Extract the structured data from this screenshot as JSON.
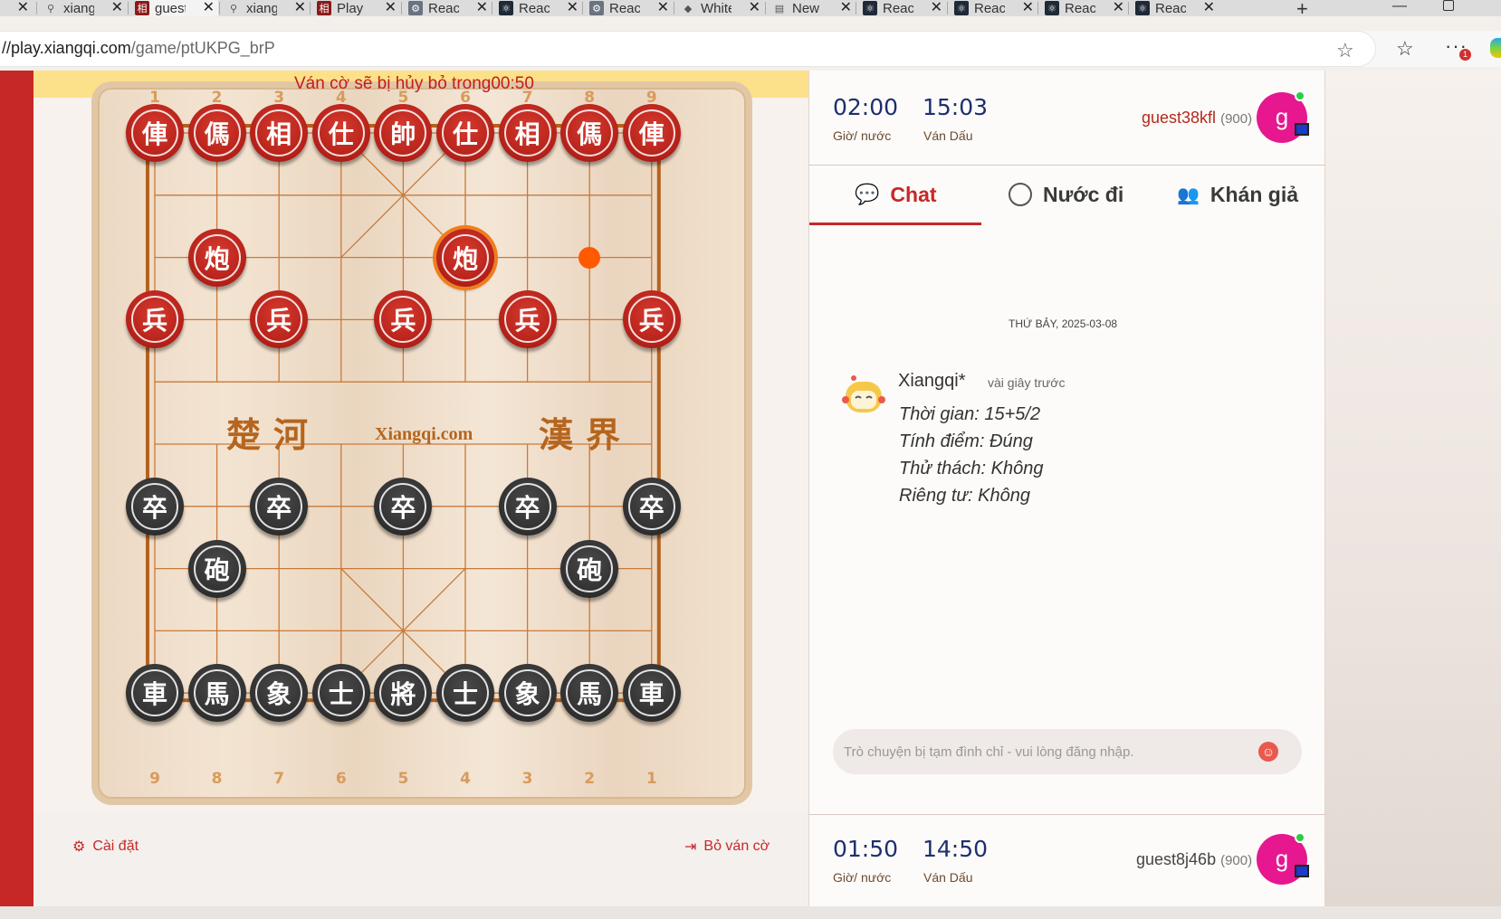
{
  "browser": {
    "tabs": [
      {
        "label": "",
        "icon": "close-icon",
        "active": false
      },
      {
        "label": "xiangq",
        "icon": "search-icon",
        "active": false
      },
      {
        "label": "guest",
        "icon": "xiangqi-favicon",
        "active": true
      },
      {
        "label": "xiangq",
        "icon": "search-icon",
        "active": false
      },
      {
        "label": "Play",
        "icon": "xiangqi-favicon",
        "active": false
      },
      {
        "label": "React",
        "icon": "gear-icon",
        "active": false
      },
      {
        "label": "React",
        "icon": "react-icon",
        "active": false
      },
      {
        "label": "React",
        "icon": "gear-icon",
        "active": false
      },
      {
        "label": "White",
        "icon": "app-icon",
        "active": false
      },
      {
        "label": "New",
        "icon": "page-icon",
        "active": false
      },
      {
        "label": "React",
        "icon": "react-icon",
        "active": false
      },
      {
        "label": "React",
        "icon": "react-icon",
        "active": false
      },
      {
        "label": "React",
        "icon": "react-icon",
        "active": false
      },
      {
        "label": "React",
        "icon": "react-icon",
        "active": false
      }
    ],
    "url_host": "//play.xiangqi.com",
    "url_path": "/game/ptUKPG_brP",
    "notification_count": "1"
  },
  "game": {
    "notice": "Ván cờ sẽ bị hủy bỏ trong00:50",
    "top_coords": [
      "1",
      "2",
      "3",
      "4",
      "5",
      "6",
      "7",
      "8",
      "9"
    ],
    "bottom_coords": [
      "9",
      "8",
      "7",
      "6",
      "5",
      "4",
      "3",
      "2",
      "1"
    ],
    "river_left": "楚河",
    "river_right": "漢界",
    "river_brand": "Xiangqi.com",
    "pieces": [
      {
        "side": "red",
        "glyph": "俥",
        "file": 0,
        "rank": 0
      },
      {
        "side": "red",
        "glyph": "傌",
        "file": 1,
        "rank": 0
      },
      {
        "side": "red",
        "glyph": "相",
        "file": 2,
        "rank": 0
      },
      {
        "side": "red",
        "glyph": "仕",
        "file": 3,
        "rank": 0
      },
      {
        "side": "red",
        "glyph": "帥",
        "file": 4,
        "rank": 0
      },
      {
        "side": "red",
        "glyph": "仕",
        "file": 5,
        "rank": 0
      },
      {
        "side": "red",
        "glyph": "相",
        "file": 6,
        "rank": 0
      },
      {
        "side": "red",
        "glyph": "傌",
        "file": 7,
        "rank": 0
      },
      {
        "side": "red",
        "glyph": "俥",
        "file": 8,
        "rank": 0
      },
      {
        "side": "red",
        "glyph": "炮",
        "file": 1,
        "rank": 2
      },
      {
        "side": "red",
        "glyph": "炮",
        "file": 5,
        "rank": 2,
        "selected": true
      },
      {
        "side": "red",
        "glyph": "兵",
        "file": 0,
        "rank": 3
      },
      {
        "side": "red",
        "glyph": "兵",
        "file": 2,
        "rank": 3
      },
      {
        "side": "red",
        "glyph": "兵",
        "file": 4,
        "rank": 3
      },
      {
        "side": "red",
        "glyph": "兵",
        "file": 6,
        "rank": 3
      },
      {
        "side": "red",
        "glyph": "兵",
        "file": 8,
        "rank": 3
      },
      {
        "side": "black",
        "glyph": "卒",
        "file": 0,
        "rank": 6
      },
      {
        "side": "black",
        "glyph": "卒",
        "file": 2,
        "rank": 6
      },
      {
        "side": "black",
        "glyph": "卒",
        "file": 4,
        "rank": 6
      },
      {
        "side": "black",
        "glyph": "卒",
        "file": 6,
        "rank": 6
      },
      {
        "side": "black",
        "glyph": "卒",
        "file": 8,
        "rank": 6
      },
      {
        "side": "black",
        "glyph": "砲",
        "file": 1,
        "rank": 7
      },
      {
        "side": "black",
        "glyph": "砲",
        "file": 7,
        "rank": 7
      },
      {
        "side": "black",
        "glyph": "車",
        "file": 0,
        "rank": 9
      },
      {
        "side": "black",
        "glyph": "馬",
        "file": 1,
        "rank": 9
      },
      {
        "side": "black",
        "glyph": "象",
        "file": 2,
        "rank": 9
      },
      {
        "side": "black",
        "glyph": "士",
        "file": 3,
        "rank": 9
      },
      {
        "side": "black",
        "glyph": "將",
        "file": 4,
        "rank": 9
      },
      {
        "side": "black",
        "glyph": "士",
        "file": 5,
        "rank": 9
      },
      {
        "side": "black",
        "glyph": "象",
        "file": 6,
        "rank": 9
      },
      {
        "side": "black",
        "glyph": "馬",
        "file": 7,
        "rank": 9
      },
      {
        "side": "black",
        "glyph": "車",
        "file": 8,
        "rank": 9
      }
    ],
    "move_hint": {
      "file": 7,
      "rank": 2
    },
    "settings_label": "Cài đặt",
    "resign_label": "Bỏ ván cờ"
  },
  "opponent": {
    "move_time": "02:00",
    "move_time_label": "Giờ/ nước",
    "game_time": "15:03",
    "game_time_label": "Ván Dấu",
    "name": "guest38kfl",
    "rating": "(900)",
    "avatar_letter": "g"
  },
  "player": {
    "move_time": "01:50",
    "move_time_label": "Giờ/ nước",
    "game_time": "14:50",
    "game_time_label": "Ván Dấu",
    "name": "guest8j46b",
    "rating": "(900)",
    "avatar_letter": "g"
  },
  "panel_tabs": {
    "chat": "Chat",
    "moves": "Nước đi",
    "spectators": "Khán giả"
  },
  "chat": {
    "date": "THỨ BẢY, 2025-03-08",
    "author": "Xiangqi*",
    "time": "vài giây trước",
    "lines": [
      "Thời gian: 15+5/2",
      "Tính điểm: Đúng",
      "Thử thách: Không",
      "Riêng tư: Không"
    ],
    "input_placeholder": "Trò chuyện bị tạm đình chỉ - vui lòng đăng nhập."
  },
  "colors": {
    "accent": "#c62828",
    "avatar": "#e6178f",
    "timer": "#1d2f6e",
    "highlight": "#ff5a00"
  }
}
